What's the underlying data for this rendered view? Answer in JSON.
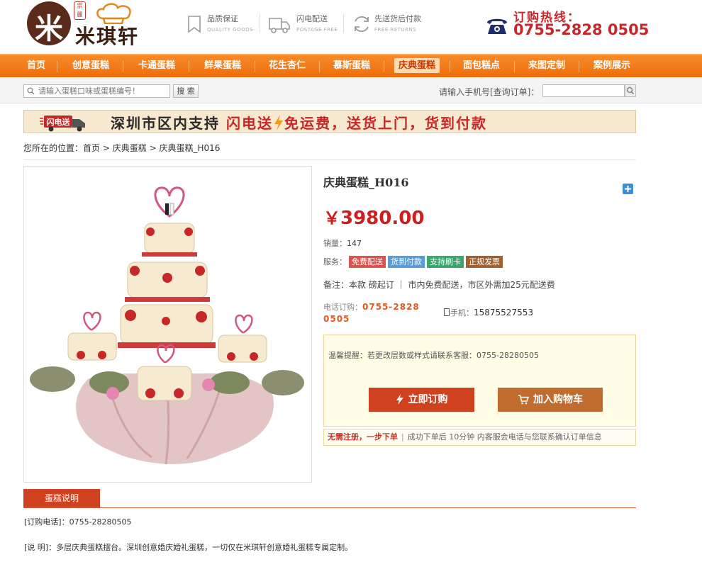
{
  "header": {
    "logo_glyph": "米",
    "logo_stamp": "宗麗",
    "logo_name": "米琪轩",
    "promos": [
      {
        "title": "品质保证",
        "subtitle": "QUALITY GOODS",
        "icon": "bookmark-icon"
      },
      {
        "title": "闪电配送",
        "subtitle": "POSTAGE FREE",
        "icon": "truck-icon"
      },
      {
        "title": "先送货后付款",
        "subtitle": "FREE RETURNS",
        "icon": "return-icon"
      }
    ],
    "hotline_label": "订购热线：",
    "hotline_number": "0755-2828 0505"
  },
  "nav": {
    "items": [
      "首页",
      "创意蛋糕",
      "卡通蛋糕",
      "鲜果蛋糕",
      "花生杏仁",
      "慕斯蛋糕",
      "庆典蛋糕",
      "面包糕点",
      "来图定制",
      "案例展示"
    ],
    "active_index": 6
  },
  "search": {
    "placeholder": "请输入蛋糕口味或蛋糕编号！",
    "button": "搜 索",
    "order_label": "请输入手机号[查询订单]：",
    "order_value": ""
  },
  "banner": {
    "badge": "闪电送",
    "text_dark": "深圳市区内支持 ",
    "text_red1": "闪电送",
    "text_red2": "免运费，送货上门，货到付款"
  },
  "breadcrumb": {
    "prefix": "您所在的位置：",
    "items": [
      "首页",
      "庆典蛋糕",
      "庆典蛋糕_H016"
    ],
    "separator": ">"
  },
  "product": {
    "title": "庆典蛋糕_H016",
    "currency": "￥",
    "price": "3980.00",
    "sales_label": "销量：",
    "sales": "147",
    "service_label": "服务：",
    "services": [
      {
        "label": "免费配送",
        "color": "#d9534f"
      },
      {
        "label": "货到付款",
        "color": "#5b9bd5"
      },
      {
        "label": "支持刷卡",
        "color": "#3aa56c"
      },
      {
        "label": "正规发票",
        "color": "#a06030"
      }
    ],
    "note_label": "备注：",
    "note": "本款  磅起订  ｜ 市内免费配送，市区外需加25元配送费",
    "tel_label": "电话订购：",
    "tel": "0755-2828 0505",
    "mobile_label": "手机：",
    "mobile": "15875527553",
    "tip": "温馨提醒：若更改层数或样式请联系客服：0755-28280505",
    "order_button": "立即订购",
    "cart_button": "加入购物车",
    "quick_highlight": "无需注册，一步下单",
    "quick_sep": "|",
    "quick_text": "成功下单后 10分钟 内客服会电话与您联系确认订单信息"
  },
  "details": {
    "tab": "蛋糕说明",
    "phone_line": "[订购电话]：0755-28280505",
    "desc_line": "[说  明]：多层庆典蛋糕摆台。深圳创意婚庆婚礼蛋糕，一切仅在米琪轩创意婚礼蛋糕专属定制。"
  },
  "colors": {
    "nav_orange": "#f07a1a",
    "price_red": "#cc1f1f",
    "order_red": "#d0411f",
    "cart_brown": "#bf6c2e"
  }
}
